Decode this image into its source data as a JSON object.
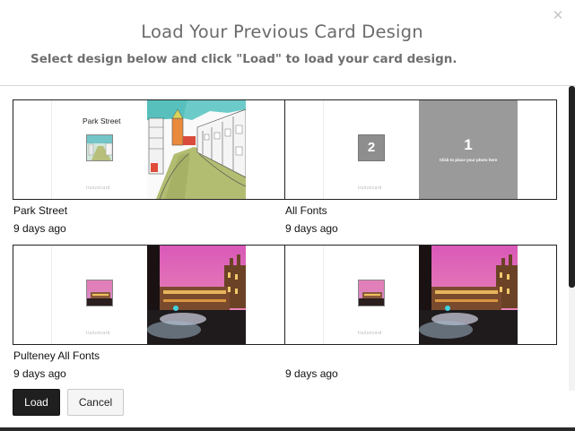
{
  "dialog": {
    "title": "Load Your Previous Card Design",
    "subtitle": "Select design below and click \"Load\" to load your card design.",
    "close_icon": "close-icon"
  },
  "designs": [
    {
      "name": "Park Street",
      "age": "9 days ago",
      "inside_text": "Park Street",
      "brand": "truluxtcard"
    },
    {
      "name": "All Fonts",
      "age": "9 days ago",
      "photo_placeholder_number": "1",
      "photo_placeholder_text": "Click to place your photo here",
      "thumb_placeholder_number": "2",
      "brand": "truluxtcard"
    },
    {
      "name": "Pulteney All Fonts",
      "age": "9 days ago",
      "brand": "truluxtcard"
    },
    {
      "name": "",
      "age": "9 days ago",
      "brand": "truluxtcard"
    }
  ],
  "buttons": {
    "load": "Load",
    "cancel": "Cancel"
  },
  "colors": {
    "load_bg": "#1f1f1f",
    "placeholder_gray": "#9a9a9a",
    "title_gray": "#6b6b6b"
  }
}
